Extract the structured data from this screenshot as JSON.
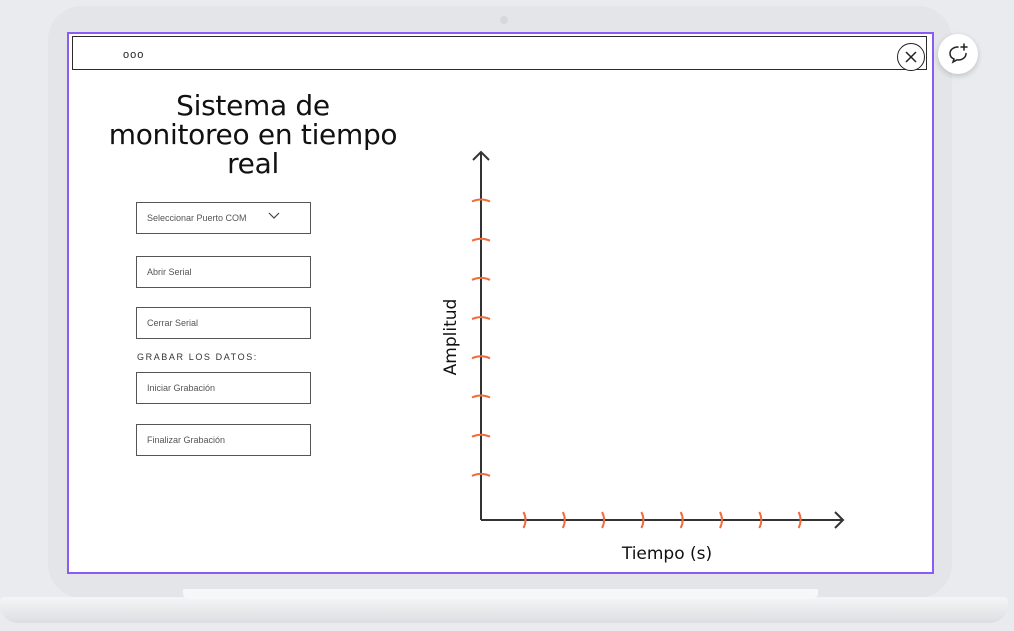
{
  "app": {
    "menu_dots": "ooo",
    "title": "Sistema de monitoreo en tiempo real"
  },
  "controls": {
    "port_select": {
      "value": "Seleccionar Puerto COM"
    },
    "open_serial": "Abrir Serial",
    "close_serial": "Cerrar Serial",
    "record_section_label": "GRABAR LOS DATOS:",
    "start_recording": "Iniciar Grabación",
    "stop_recording": "Finalizar Grabación"
  },
  "chart_data": {
    "type": "line",
    "xlabel": "Tiempo (s)",
    "ylabel": "Amplitud",
    "series": [],
    "x_tick_count": 8,
    "y_tick_count": 8,
    "tick_color": "#f26b3a",
    "axis_color": "#333333"
  },
  "icons": {
    "close": "close-icon",
    "comment_add": "comment-add-icon",
    "dropdown": "chevron-down-icon"
  }
}
